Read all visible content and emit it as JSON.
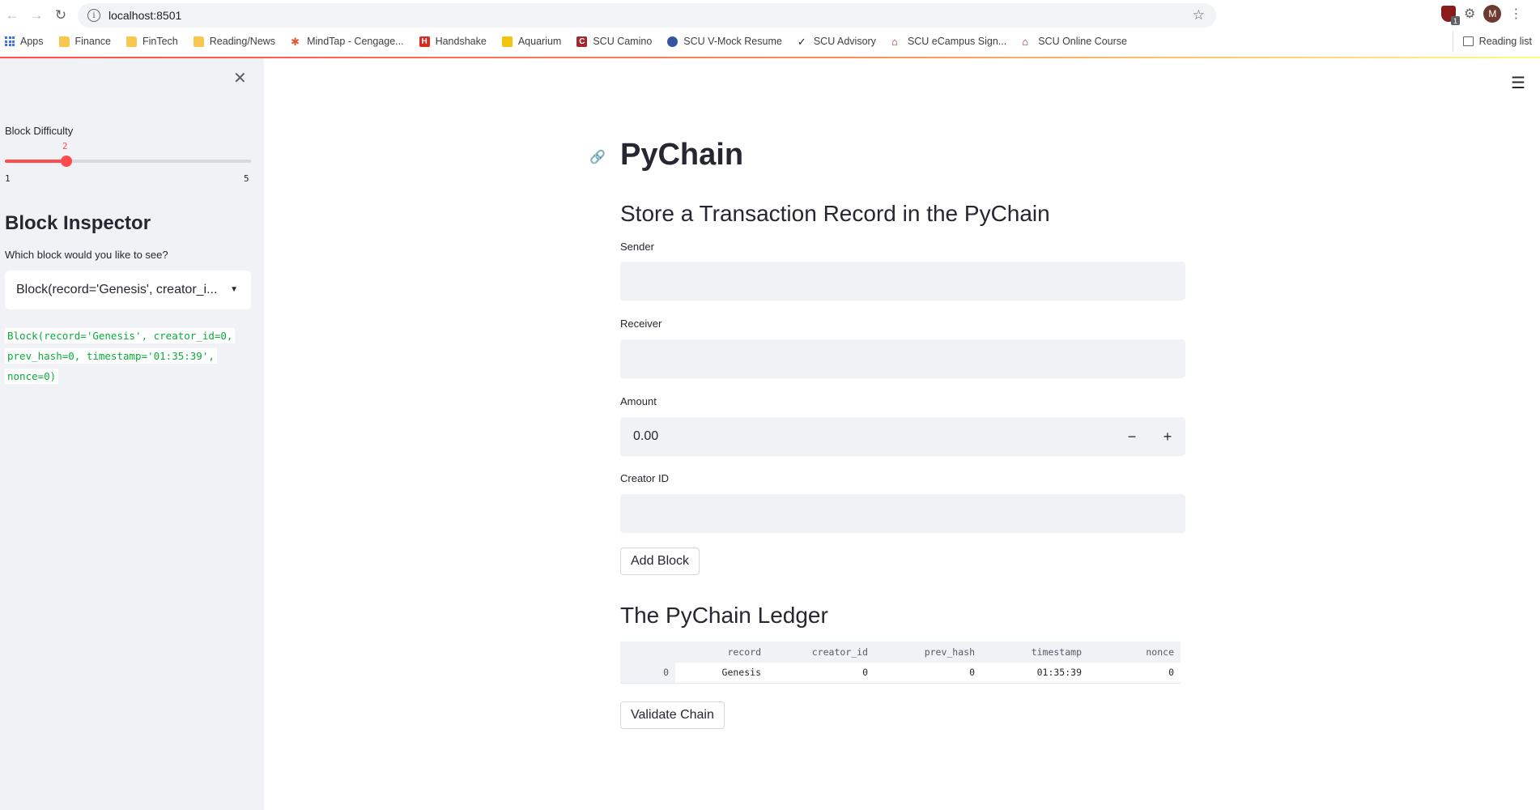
{
  "browser": {
    "url": "localhost:8501",
    "bookmarks": [
      {
        "label": "Apps",
        "icon": "apps-grid-icon"
      },
      {
        "label": "Finance",
        "icon": "folder-icon"
      },
      {
        "label": "FinTech",
        "icon": "folder-icon"
      },
      {
        "label": "Reading/News",
        "icon": "folder-icon"
      },
      {
        "label": "MindTap - Cengage...",
        "icon": "mindtap-icon"
      },
      {
        "label": "Handshake",
        "icon": "handshake-icon"
      },
      {
        "label": "Aquarium",
        "icon": "aquarium-icon"
      },
      {
        "label": "SCU Camino",
        "icon": "camino-icon"
      },
      {
        "label": "SCU V-Mock Resume",
        "icon": "vmock-icon"
      },
      {
        "label": "SCU Advisory",
        "icon": "advisory-icon"
      },
      {
        "label": "SCU eCampus Sign...",
        "icon": "scu-icon"
      },
      {
        "label": "SCU Online Course",
        "icon": "scu-icon"
      }
    ],
    "reading_list": "Reading list",
    "profile_initial": "M",
    "extension_badge": "1"
  },
  "sidebar": {
    "slider": {
      "label": "Block Difficulty",
      "value": 2,
      "min": 1,
      "max": 5,
      "value_text": "2",
      "min_text": "1",
      "max_text": "5"
    },
    "inspector_title": "Block Inspector",
    "inspector_question": "Which block would you like to see?",
    "select_value": "Block(record='Genesis', creator_i...",
    "code_lines": [
      "Block(record='Genesis', creator_id=0,",
      "prev_hash=0, timestamp='01:35:39',",
      "nonce=0)"
    ]
  },
  "main": {
    "title": "PyChain",
    "form_header": "Store a Transaction Record in the PyChain",
    "sender_label": "Sender",
    "sender_value": "",
    "receiver_label": "Receiver",
    "receiver_value": "",
    "amount_label": "Amount",
    "amount_value": "0.00",
    "decrement": "−",
    "increment": "+",
    "creator_label": "Creator ID",
    "creator_value": "",
    "add_button": "Add Block",
    "ledger_title": "The PyChain Ledger",
    "ledger": {
      "columns": [
        "",
        "record",
        "creator_id",
        "prev_hash",
        "timestamp",
        "nonce"
      ],
      "rows": [
        [
          "0",
          "Genesis",
          "0",
          "0",
          "01:35:39",
          "0"
        ]
      ]
    },
    "validate_button": "Validate Chain"
  },
  "colors": {
    "accent": "#ff4b4b",
    "sidebar_bg": "#f0f2f6",
    "code_green": "#09ab3b"
  }
}
